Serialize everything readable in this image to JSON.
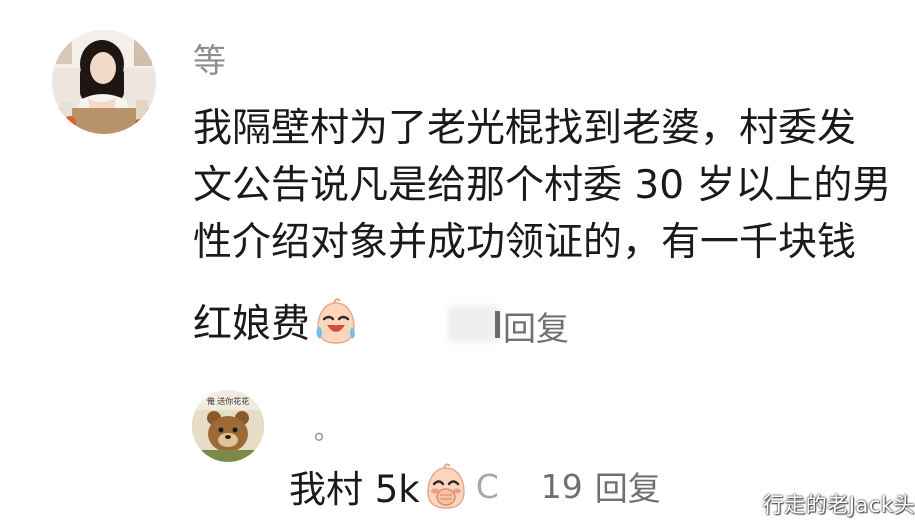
{
  "main_comment": {
    "username": "等",
    "lines": [
      "我隔壁村为了老光棍找到老婆，村委发",
      "文公告说凡是给那个村委 30 岁以上的男",
      "性介绍对象并成功领证的，有一千块钱"
    ],
    "last_line": "红娘费",
    "emoji": "crying-laughing-emoji",
    "reply_label": "回复"
  },
  "reply": {
    "username": "。",
    "avatar_caption": "俺 送你花花",
    "text": "我村 5k",
    "emoji": "covering-mouth-laughing-emoji",
    "meta_fragment": "C",
    "like_count": "19",
    "reply_label": "回复"
  },
  "watermark": "行走的老Jack头",
  "colors": {
    "text_primary": "#1a1a1a",
    "text_secondary": "#707070",
    "username": "#8e8e8e",
    "background": "#ffffff"
  }
}
